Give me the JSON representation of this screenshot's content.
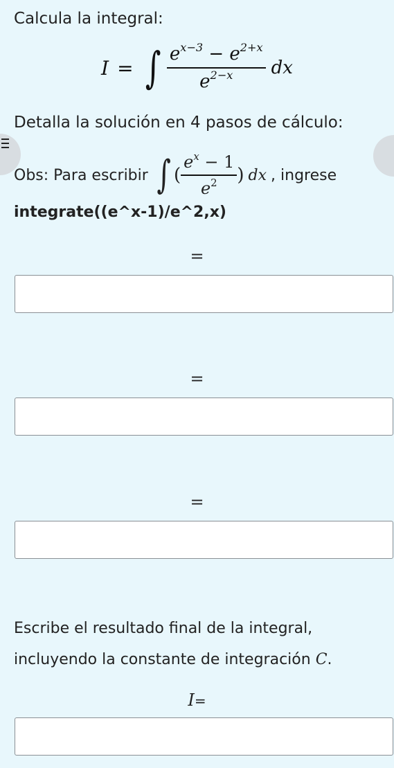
{
  "prompt": {
    "heading": "Calcula la integral:",
    "steps_instruction": "Detalla la solución en 4 pasos de cálculo:",
    "obs_prefix": "Obs: Para escribir",
    "obs_suffix": ", ingrese",
    "hint_syntax": "integrate((e^x-1)/e^2,x)"
  },
  "main_formula": {
    "lhs": "I",
    "equals": "=",
    "integral_sign": "∫",
    "num_base1": "e",
    "num_exp1": "x−3",
    "num_minus": " − ",
    "num_base2": "e",
    "num_exp2": "2+x",
    "den_base": "e",
    "den_exp": "2−x",
    "differential": "dx"
  },
  "example_formula": {
    "integral_sign": "∫",
    "open_paren": "(",
    "num_base": "e",
    "num_exp": "x",
    "num_rest": " − 1",
    "den_base": "e",
    "den_exp": "2",
    "close_paren": ")",
    "differential": "dx"
  },
  "steps": [
    {
      "equals": "=",
      "value": ""
    },
    {
      "equals": "=",
      "value": ""
    },
    {
      "equals": "=",
      "value": ""
    }
  ],
  "final": {
    "instruction_line1": "Escribe el resultado final de la integral,",
    "instruction_line2_prefix": "incluyendo la constante de integración ",
    "constant_symbol": "C",
    "instruction_line2_suffix": ".",
    "label_var": "I",
    "label_equals": "=",
    "value": ""
  }
}
